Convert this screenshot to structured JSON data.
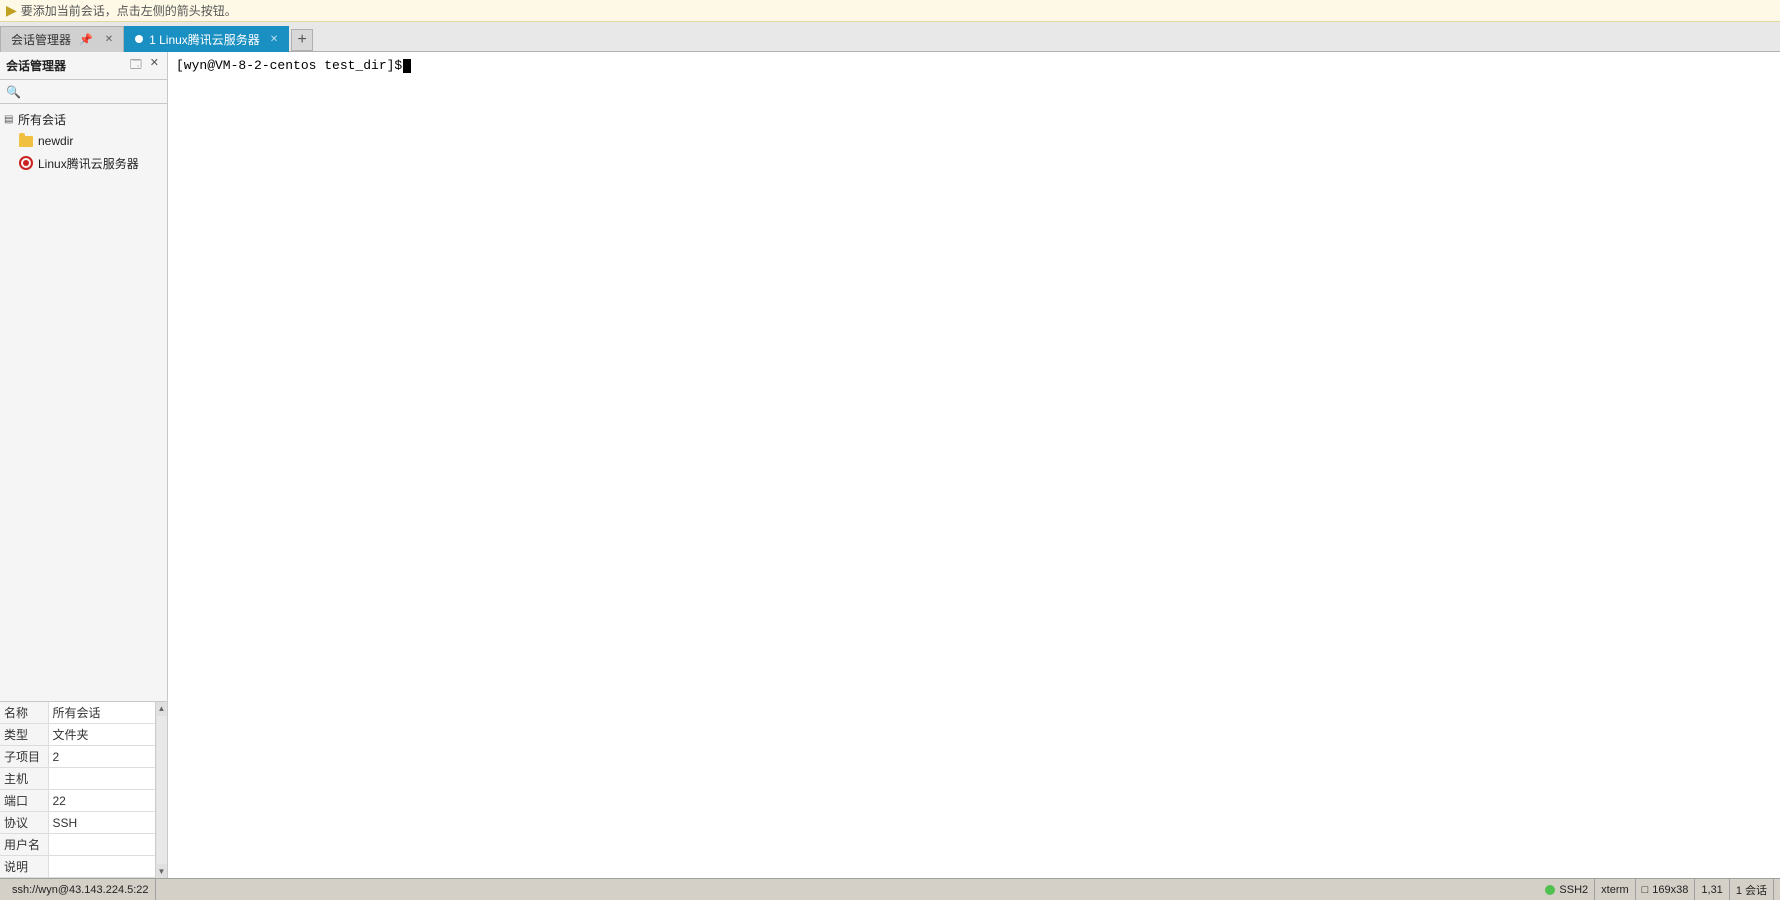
{
  "topbar": {
    "notice": "要添加当前会话，点击左侧的箭头按钮。"
  },
  "tabs": [
    {
      "id": "session-manager",
      "label": "会话管理器",
      "active": false,
      "showDot": false
    },
    {
      "id": "linux-server",
      "label": "1 Linux腾讯云服务器",
      "active": true,
      "showDot": true
    }
  ],
  "tab_add_label": "+",
  "sidebar": {
    "title": "会话管理器",
    "pin_icon": "📌",
    "close_icon": "✕",
    "search_placeholder": "",
    "tree": [
      {
        "id": "all-sessions",
        "label": "所有会话",
        "type": "root",
        "indent": 0,
        "expanded": true
      },
      {
        "id": "newdir",
        "label": "newdir",
        "type": "folder",
        "indent": 1
      },
      {
        "id": "linux-server",
        "label": "Linux腾讯云服务器",
        "type": "server",
        "indent": 1
      }
    ]
  },
  "properties": [
    {
      "key": "名称",
      "value": "所有会话"
    },
    {
      "key": "类型",
      "value": "文件夹"
    },
    {
      "key": "子项目",
      "value": "2"
    },
    {
      "key": "主机",
      "value": ""
    },
    {
      "key": "端口",
      "value": "22"
    },
    {
      "key": "协议",
      "value": "SSH"
    },
    {
      "key": "用户名",
      "value": ""
    },
    {
      "key": "说明",
      "value": ""
    }
  ],
  "terminal": {
    "prompt": "[wyn@VM-8-2-centos test_dir]$ "
  },
  "statusbar": {
    "ssh_url": "ssh://wyn@43.143.224.5:22",
    "protocol": "SSH2",
    "terminal_type": "xterm",
    "dimensions_label": "169x38",
    "cursor_pos": "1,31",
    "sessions_label": "1 会话"
  }
}
